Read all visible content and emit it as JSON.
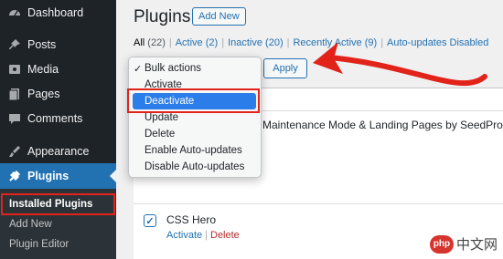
{
  "sidebar": {
    "items": [
      {
        "label": "Dashboard",
        "icon": "dashboard-icon"
      },
      {
        "label": "Posts",
        "icon": "pin-icon"
      },
      {
        "label": "Media",
        "icon": "media-icon"
      },
      {
        "label": "Pages",
        "icon": "pages-icon"
      },
      {
        "label": "Comments",
        "icon": "comment-icon"
      },
      {
        "label": "Appearance",
        "icon": "brush-icon"
      },
      {
        "label": "Plugins",
        "icon": "plug-icon"
      }
    ],
    "submenu": [
      {
        "label": "Installed Plugins"
      },
      {
        "label": "Add New"
      },
      {
        "label": "Plugin Editor"
      }
    ]
  },
  "header": {
    "title": "Plugins",
    "add_new": "Add New"
  },
  "filters": {
    "all": "All",
    "all_count": "(22)",
    "active": "Active",
    "active_count": "(2)",
    "inactive": "Inactive",
    "inactive_count": "(20)",
    "recently_active": "Recently Active",
    "recently_active_count": "(9)",
    "auto_updates": "Auto-updates Disabled"
  },
  "bulk": {
    "apply_label": "Apply",
    "options": [
      {
        "label": "Bulk actions",
        "checked": true
      },
      {
        "label": "Activate"
      },
      {
        "label": "Deactivate",
        "selected": true
      },
      {
        "label": "Update"
      },
      {
        "label": "Delete"
      },
      {
        "label": "Enable Auto-updates"
      },
      {
        "label": "Disable Auto-updates"
      }
    ]
  },
  "plugins": [
    {
      "name": "Maintenance Mode & Landing Pages by SeedProd"
    },
    {
      "name": "CSS Hero",
      "actions": {
        "activate": "Activate",
        "delete": "Delete"
      }
    }
  ],
  "watermark": {
    "logo": "php",
    "text": "中文网"
  },
  "colors": {
    "sidebar_bg": "#1d2327",
    "accent": "#2271b1",
    "highlight": "#e2231a",
    "selected": "#2b7de9"
  }
}
